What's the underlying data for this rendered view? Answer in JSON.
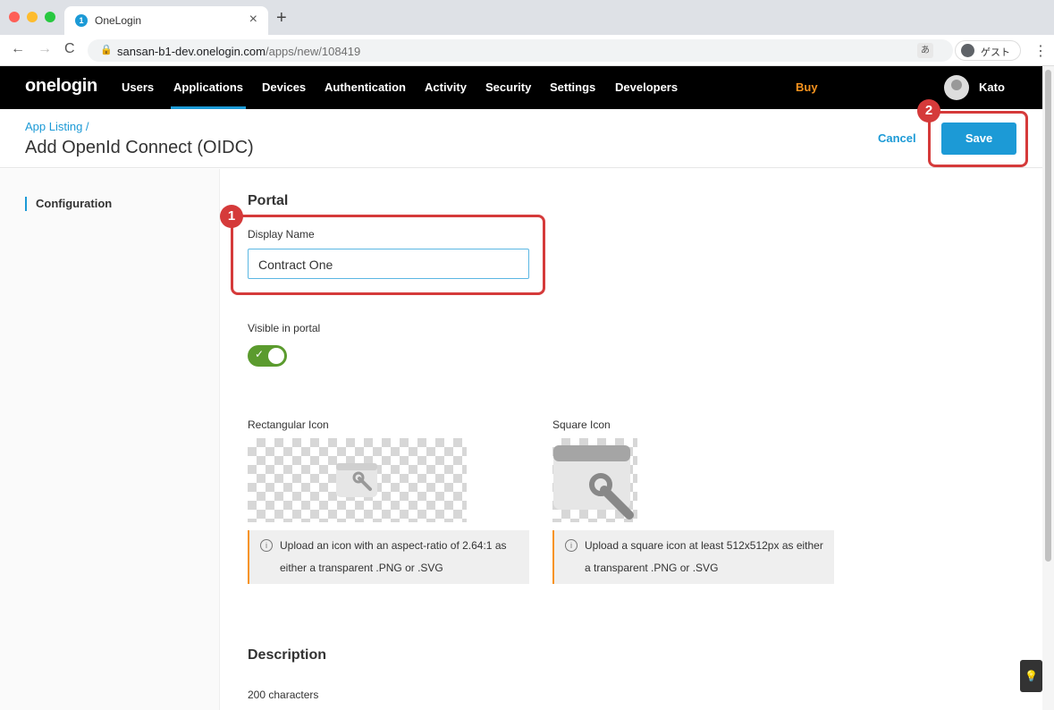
{
  "browser": {
    "tab_title": "OneLogin",
    "tab_favicon": "1",
    "url_host": "sansan-b1-dev.onelogin.com",
    "url_path": "/apps/new/108419",
    "guest_label": "ゲスト",
    "translate_label": "あ"
  },
  "nav": {
    "logo": "onelogin",
    "items": [
      "Users",
      "Applications",
      "Devices",
      "Authentication",
      "Activity",
      "Security",
      "Settings",
      "Developers"
    ],
    "buy": "Buy",
    "user": "Kato"
  },
  "header": {
    "breadcrumb": "App Listing /",
    "title": "Add OpenId Connect (OIDC)",
    "cancel": "Cancel",
    "save": "Save"
  },
  "sidebar": {
    "items": [
      "Configuration"
    ]
  },
  "main": {
    "portal_title": "Portal",
    "display_name_label": "Display Name",
    "display_name_value": "Contract One",
    "visible_label": "Visible in portal",
    "visible_on": true,
    "rect_icon_label": "Rectangular Icon",
    "square_icon_label": "Square Icon",
    "rect_icon_hint": "Upload an icon with an aspect-ratio of 2.64:1 as either a transparent .PNG or .SVG",
    "square_icon_hint": "Upload a square icon at least 512x512px as either a transparent .PNG or .SVG",
    "description_title": "Description",
    "description_count": "200 characters"
  },
  "annotations": {
    "badge1": "1",
    "badge2": "2"
  },
  "colors": {
    "accent": "#1c9ad6",
    "buy": "#f7931e",
    "toggle_on": "#5b9b2e",
    "annotation": "#d53a3a"
  }
}
